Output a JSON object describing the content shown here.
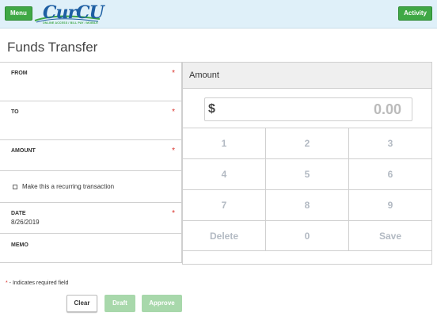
{
  "header": {
    "menu_label": "Menu",
    "activity_label": "Activity",
    "logo_text": "CurCU",
    "logo_tagline": "ONLINE ACCESS / BILL PAY / MOBILE"
  },
  "page_title": "Funds Transfer",
  "form": {
    "from_label": "FROM",
    "to_label": "TO",
    "amount_label": "AMOUNT",
    "recurring_label": "Make this a recurring transaction",
    "recurring_checked": false,
    "date_label": "DATE",
    "date_value": "8/26/2019",
    "memo_label": "MEMO",
    "required_mark": "*"
  },
  "amount_panel": {
    "title": "Amount",
    "currency_symbol": "$",
    "value": "0.00",
    "keys": [
      [
        "1",
        "2",
        "3"
      ],
      [
        "4",
        "5",
        "6"
      ],
      [
        "7",
        "8",
        "9"
      ],
      [
        "Delete",
        "0",
        "Save"
      ]
    ]
  },
  "footer": {
    "required_star": "*",
    "required_note": " - Indicates required field",
    "clear_label": "Clear",
    "draft_label": "Draft",
    "approve_label": "Approve"
  },
  "colors": {
    "header_bg": "#dff0f9",
    "accent_green": "#3fa845",
    "disabled_green": "#a8d8ab",
    "required_red": "#d9312b",
    "brand_blue": "#1e5fa3"
  }
}
